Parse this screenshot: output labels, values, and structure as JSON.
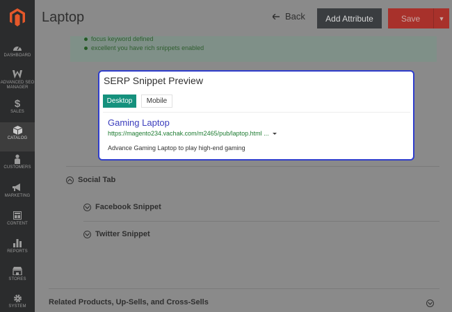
{
  "header": {
    "title": "Laptop",
    "back_label": "Back",
    "add_attribute_label": "Add Attribute",
    "save_label": "Save"
  },
  "sidebar": {
    "items": [
      {
        "label": "DASHBOARD",
        "icon": "dashboard-icon"
      },
      {
        "label": "ADVANCED SEO MANAGER",
        "icon": "seo-icon"
      },
      {
        "label": "SALES",
        "icon": "dollar-icon"
      },
      {
        "label": "CATALOG",
        "icon": "box-icon",
        "active": true
      },
      {
        "label": "CUSTOMERS",
        "icon": "person-icon"
      },
      {
        "label": "MARKETING",
        "icon": "megaphone-icon"
      },
      {
        "label": "CONTENT",
        "icon": "layout-icon"
      },
      {
        "label": "REPORTS",
        "icon": "bar-chart-icon"
      },
      {
        "label": "STORES",
        "icon": "store-icon"
      },
      {
        "label": "SYSTEM",
        "icon": "gear-icon"
      }
    ]
  },
  "notice": {
    "lines": [
      "focus keyword defined",
      "excellent you have rich snippets enabled"
    ]
  },
  "serp": {
    "title": "SERP Snippet Preview",
    "tabs": {
      "desktop": "Desktop",
      "mobile": "Mobile"
    },
    "result_title": "Gaming Laptop",
    "result_url": "https://magento234.vachak.com/m2465/pub/laptop.html ...",
    "result_description": "Advance Gaming Laptop to play high-end gaming"
  },
  "sections": {
    "social_tab": "Social Tab",
    "facebook_snippet": "Facebook Snippet",
    "twitter_snippet": "Twitter Snippet",
    "related": "Related Products, Up-Sells, and Cross-Sells"
  },
  "colors": {
    "sidebar_bg": "#2b2c2d",
    "save": "#a8312b",
    "tab_active": "#15917d",
    "serp_border": "#2f3dcc",
    "result_link": "#3b3dbd",
    "url_green": "#1b7a2f"
  }
}
